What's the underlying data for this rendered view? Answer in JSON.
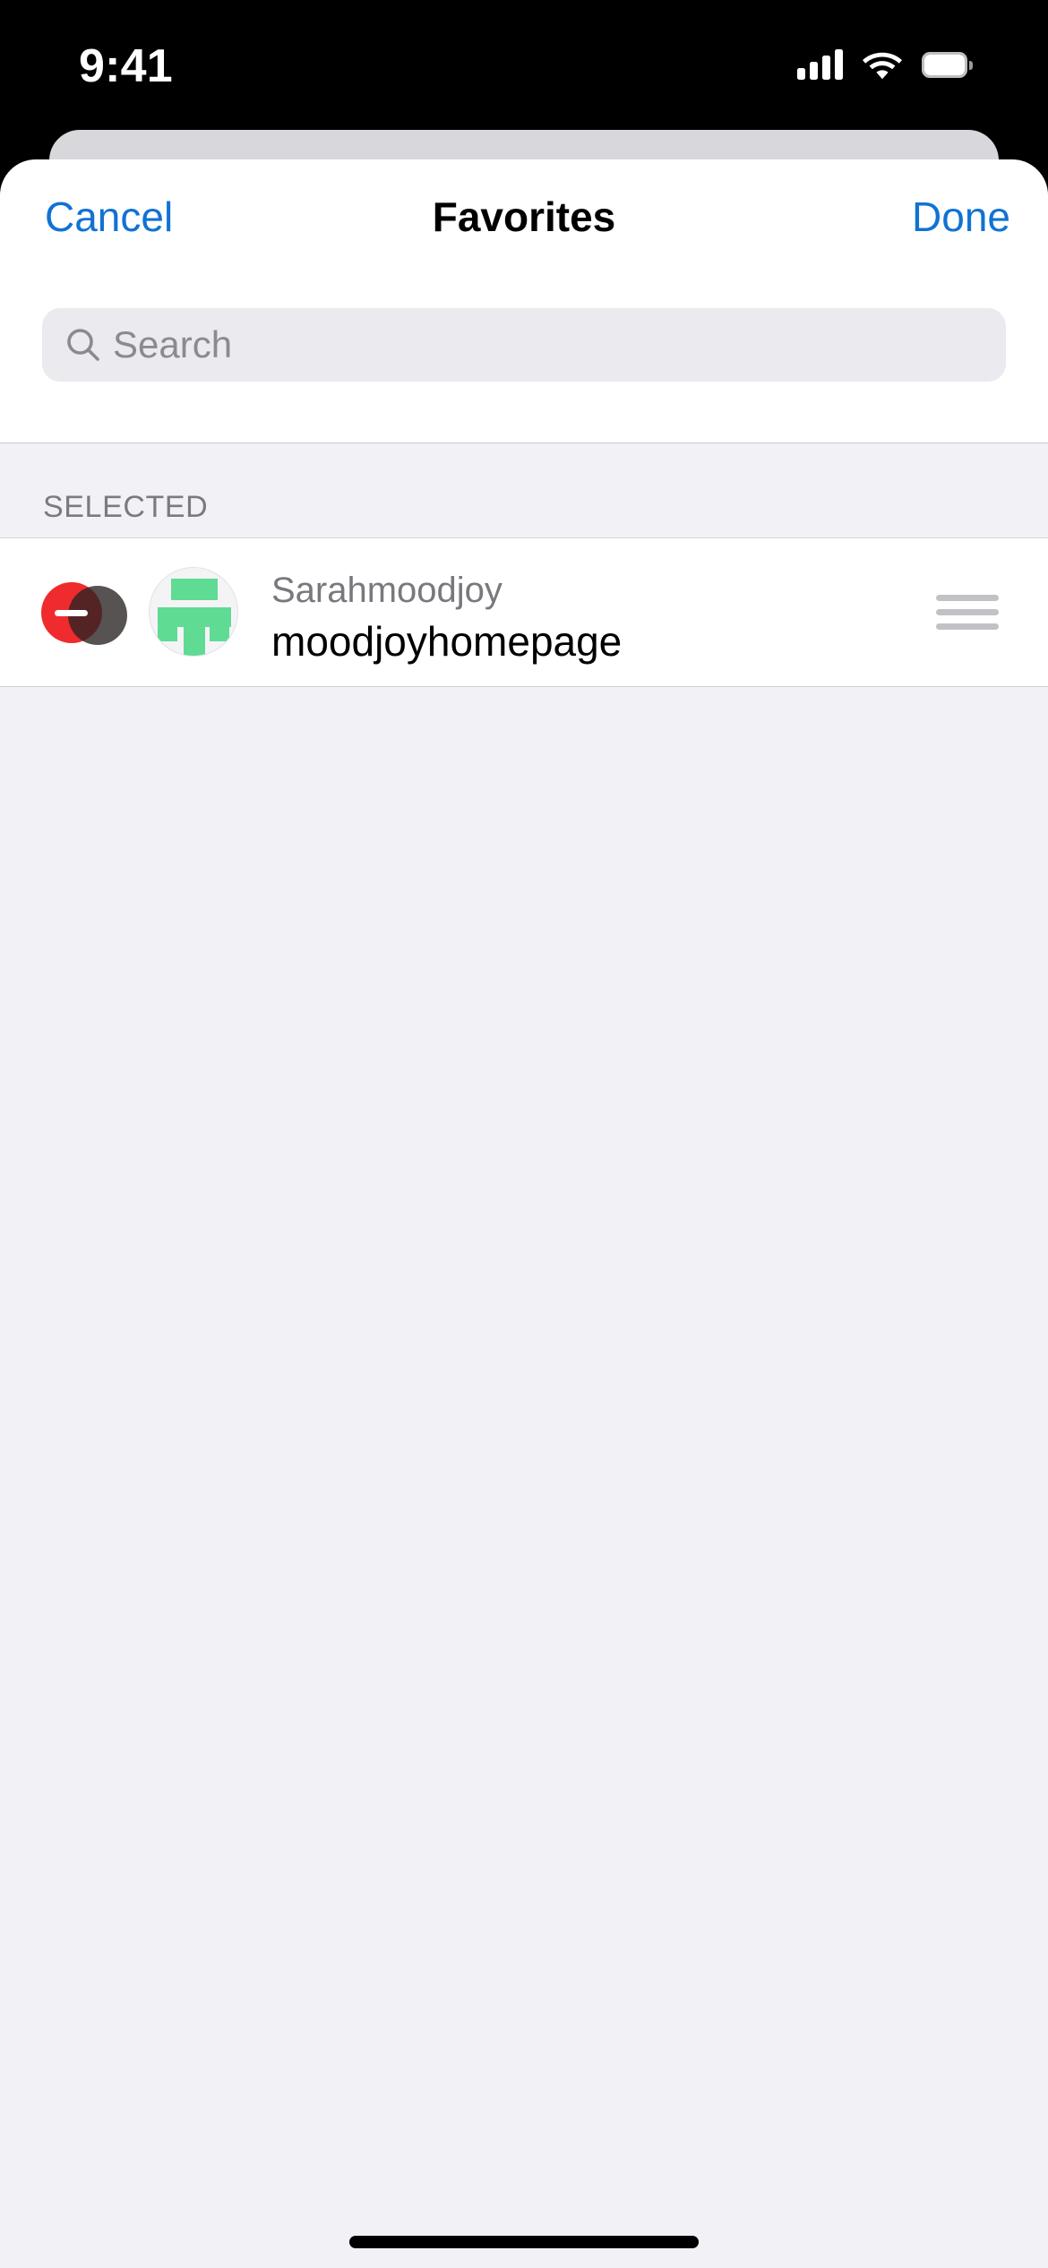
{
  "status_bar": {
    "time": "9:41",
    "icons": {
      "cellular": "cellular-signal-icon",
      "wifi": "wifi-icon",
      "battery": "battery-icon"
    }
  },
  "sheet": {
    "nav": {
      "cancel_label": "Cancel",
      "title": "Favorites",
      "done_label": "Done"
    },
    "search": {
      "placeholder": "Search",
      "value": "",
      "icon": "search-icon"
    },
    "sections": [
      {
        "header": "SELECTED",
        "rows": [
          {
            "remove_icon": "remove-circle-minus-icon",
            "avatar_icon": "moodjoy-avatar-icon",
            "subtitle": "Sarahmoodjoy",
            "title": "moodjoyhomepage",
            "reorder_icon": "reorder-handle-icon"
          }
        ]
      }
    ]
  },
  "colors": {
    "accent_blue": "#1172d3",
    "remove_red": "#ef2b2d",
    "avatar_green": "#5fdb94",
    "sheet_background": "#f1f1f6",
    "row_background": "#ffffff",
    "secondary_text": "#78787e",
    "header_text": "#7a7a80"
  },
  "home_indicator": "home-indicator"
}
